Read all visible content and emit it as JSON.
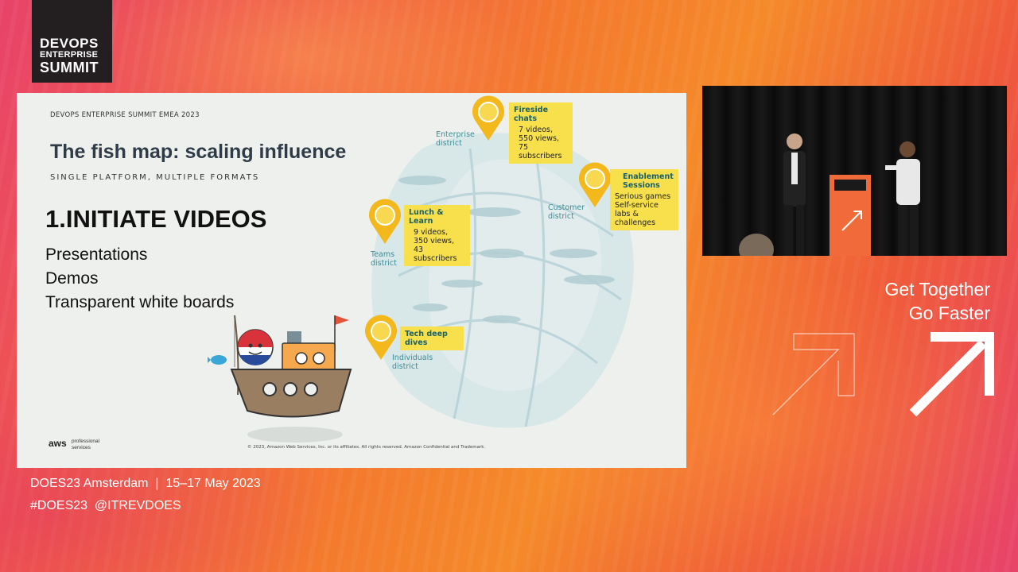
{
  "branding": {
    "logo_line1": "DEVOPS",
    "logo_line2": "ENTERPRISE",
    "logo_line3": "SUMMIT"
  },
  "slide": {
    "event_label": "DEVOPS ENTERPRISE SUMMIT EMEA 2023",
    "title": "The fish map: scaling influence",
    "subtitle": "SINGLE PLATFORM, MULTIPLE FORMATS",
    "section_heading": "1.INITIATE VIDEOS",
    "bullets": [
      "Presentations",
      "Demos",
      "Transparent white boards"
    ],
    "callouts": [
      {
        "title": "Fireside chats",
        "lines": [
          "7 videos,",
          "550 views,",
          "75 subscribers"
        ]
      },
      {
        "title": "Enablement Sessions",
        "lines": [
          "Serious games",
          "Self-service labs &",
          "challenges"
        ]
      },
      {
        "title": "Lunch & Learn",
        "lines": [
          "9 videos,",
          "350 views,",
          "43 subscribers"
        ]
      },
      {
        "title": "Tech deep dives",
        "lines": []
      }
    ],
    "districts": [
      "Enterprise district",
      "Customer district",
      "Teams district",
      "Individuals district"
    ],
    "copyright": "© 2023, Amazon Web Services, Inc. or its affiliates. All rights reserved. Amazon Confidential and Trademark.",
    "aws_logo": "aws",
    "aws_sub": "professional services"
  },
  "overlay": {
    "tagline_line1": "Get Together",
    "tagline_line2": "Go Faster",
    "footer_line1": "DOES23 Amsterdam  |  15–17 May 2023",
    "footer_line2": "#DOES23  @ITREVDOES"
  },
  "colors": {
    "callout_yellow": "#f7e04c",
    "pin_gold": "#f2b81c",
    "district_teal": "#3d8c96"
  }
}
